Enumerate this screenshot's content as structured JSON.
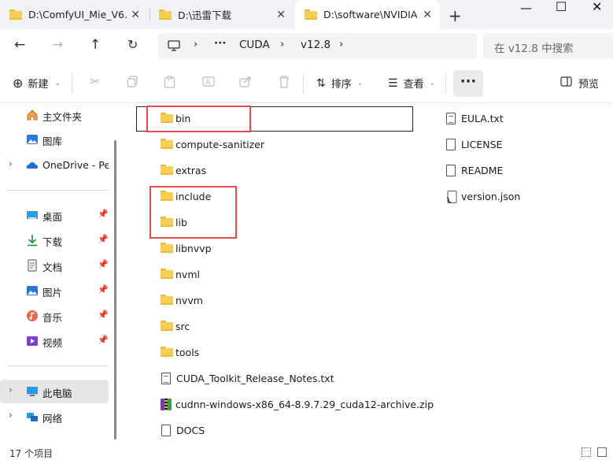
{
  "tabs": [
    {
      "title": "D:\\ComfyUI_Mie_V6.",
      "icon": "folder-icon"
    },
    {
      "title": "D:\\迅雷下载",
      "icon": "folder-icon"
    },
    {
      "title": "D:\\software\\NVIDIA",
      "icon": "folder-icon",
      "active": true
    }
  ],
  "new_tab": "+",
  "window": {
    "minimize": "—",
    "maximize": "☐",
    "close": "✕"
  },
  "nav": {
    "back": "←",
    "forward": "→",
    "up": "↑",
    "refresh": "↻"
  },
  "address": {
    "device_icon": "monitor-icon",
    "sep1": "›",
    "ellipsis": "···",
    "crumb1": "CUDA",
    "sep2": "›",
    "crumb2": "v12.8",
    "sep3": "›"
  },
  "search": {
    "placeholder": "在 v12.8 中搜索"
  },
  "commands": {
    "new": "新建",
    "sort": "排序",
    "view": "查看",
    "more": "···",
    "preview": "预览"
  },
  "sidebar": {
    "items": [
      {
        "label": "主文件夹",
        "icon": "home-icon"
      },
      {
        "label": "图库",
        "icon": "gallery-icon"
      },
      {
        "label": "OneDrive - Per",
        "icon": "cloud-icon"
      },
      {
        "label": "桌面",
        "icon": "desktop-icon"
      },
      {
        "label": "下载",
        "icon": "download-icon"
      },
      {
        "label": "文档",
        "icon": "documents-icon"
      },
      {
        "label": "图片",
        "icon": "pictures-icon"
      },
      {
        "label": "音乐",
        "icon": "music-icon"
      },
      {
        "label": "视频",
        "icon": "videos-icon"
      },
      {
        "label": "此电脑",
        "icon": "this-pc-icon"
      },
      {
        "label": "网络",
        "icon": "network-icon"
      }
    ]
  },
  "files": {
    "column1": [
      {
        "name": "bin",
        "type": "folder"
      },
      {
        "name": "compute-sanitizer",
        "type": "folder"
      },
      {
        "name": "extras",
        "type": "folder"
      },
      {
        "name": "include",
        "type": "folder"
      },
      {
        "name": "lib",
        "type": "folder"
      },
      {
        "name": "libnvvp",
        "type": "folder"
      },
      {
        "name": "nvml",
        "type": "folder"
      },
      {
        "name": "nvvm",
        "type": "folder"
      },
      {
        "name": "src",
        "type": "folder"
      },
      {
        "name": "tools",
        "type": "folder"
      },
      {
        "name": "CUDA_Toolkit_Release_Notes.txt",
        "type": "text"
      },
      {
        "name": "cudnn-windows-x86_64-8.9.7.29_cuda12-archive.zip",
        "type": "zip"
      },
      {
        "name": "DOCS",
        "type": "file"
      }
    ],
    "column2": [
      {
        "name": "EULA.txt",
        "type": "text"
      },
      {
        "name": "LICENSE",
        "type": "file"
      },
      {
        "name": "README",
        "type": "file"
      },
      {
        "name": "version.json",
        "type": "json"
      }
    ]
  },
  "status": {
    "count": "17 个项目"
  },
  "colors": {
    "highlight": "#e84a4a",
    "folder": "#f5cf55",
    "selection": "#e6e6e6"
  }
}
